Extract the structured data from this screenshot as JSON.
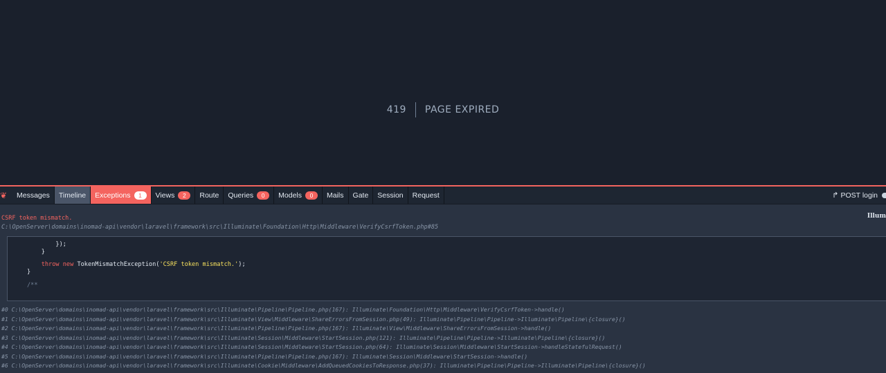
{
  "error": {
    "code": "419",
    "message": "PAGE EXPIRED"
  },
  "debugbar": {
    "tabs": [
      {
        "label": "Messages",
        "badge": null
      },
      {
        "label": "Timeline",
        "badge": null
      },
      {
        "label": "Exceptions",
        "badge": "1"
      },
      {
        "label": "Views",
        "badge": "2"
      },
      {
        "label": "Route",
        "badge": null
      },
      {
        "label": "Queries",
        "badge": "0"
      },
      {
        "label": "Models",
        "badge": "0"
      },
      {
        "label": "Mails",
        "badge": null
      },
      {
        "label": "Gate",
        "badge": null
      },
      {
        "label": "Session",
        "badge": null
      },
      {
        "label": "Request",
        "badge": null
      }
    ],
    "active_tab": "Timeline",
    "error_tab": "Exceptions",
    "request_label": "POST login",
    "exception": {
      "title": "CSRF token mismatch.",
      "class_fragment": "Illum",
      "file": "C:\\OpenServer\\domains\\inomad-api\\vendor\\laravel\\framework\\src\\Illuminate\\Foundation\\Http\\Middleware\\VerifyCsrfToken.php#85",
      "code": {
        "line1": "        });",
        "line2": "    }",
        "line3_kw1": "    throw new ",
        "line3_mid": "TokenMismatchException(",
        "line3_str": "'CSRF token mismatch.'",
        "line3_end": ");",
        "line4": "}",
        "line5": "/**"
      },
      "trace": [
        "#0 C:\\OpenServer\\domains\\inomad-api\\vendor\\laravel\\framework\\src\\Illuminate\\Pipeline\\Pipeline.php(167): Illuminate\\Foundation\\Http\\Middleware\\VerifyCsrfToken->handle()",
        "#1 C:\\OpenServer\\domains\\inomad-api\\vendor\\laravel\\framework\\src\\Illuminate\\View\\Middleware\\ShareErrorsFromSession.php(49): Illuminate\\Pipeline\\Pipeline->Illuminate\\Pipeline\\{closure}()",
        "#2 C:\\OpenServer\\domains\\inomad-api\\vendor\\laravel\\framework\\src\\Illuminate\\Pipeline\\Pipeline.php(167): Illuminate\\View\\Middleware\\ShareErrorsFromSession->handle()",
        "#3 C:\\OpenServer\\domains\\inomad-api\\vendor\\laravel\\framework\\src\\Illuminate\\Session\\Middleware\\StartSession.php(121): Illuminate\\Pipeline\\Pipeline->Illuminate\\Pipeline\\{closure}()",
        "#4 C:\\OpenServer\\domains\\inomad-api\\vendor\\laravel\\framework\\src\\Illuminate\\Session\\Middleware\\StartSession.php(64): Illuminate\\Session\\Middleware\\StartSession->handleStatefulRequest()",
        "#5 C:\\OpenServer\\domains\\inomad-api\\vendor\\laravel\\framework\\src\\Illuminate\\Pipeline\\Pipeline.php(167): Illuminate\\Session\\Middleware\\StartSession->handle()",
        "#6 C:\\OpenServer\\domains\\inomad-api\\vendor\\laravel\\framework\\src\\Illuminate\\Cookie\\Middleware\\AddQueuedCookiesToResponse.php(37): Illuminate\\Pipeline\\Pipeline->Illuminate\\Pipeline\\{closure}()"
      ]
    }
  },
  "colors": {
    "accent": "#f4645f",
    "background": "#1a202c",
    "bar": "#2a3342"
  },
  "icons": {
    "brand": "laravel-logo-icon",
    "request": "redirect-arrow-icon"
  }
}
